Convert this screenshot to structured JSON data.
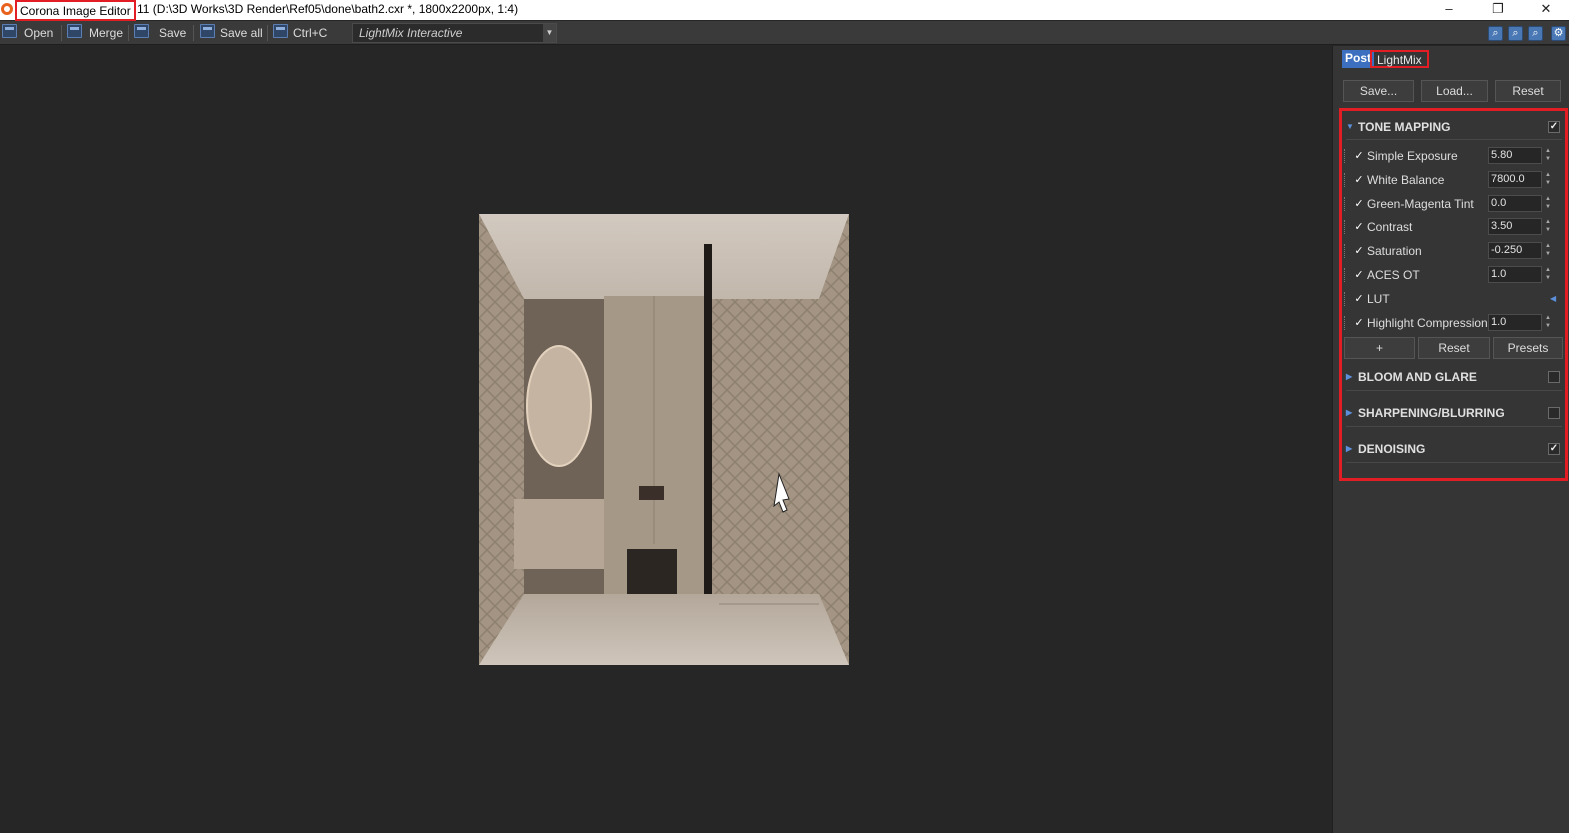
{
  "titlebar": {
    "app_name": "Corona Image Editor",
    "doc_info": "11 (D:\\3D Works\\3D Render\\Ref05\\done\\bath2.cxr *, 1800x2200px, 1:4)",
    "minimize": "–",
    "restore": "❐",
    "close": "✕"
  },
  "toolbar": {
    "open_label": "Open",
    "merge_label": "Merge",
    "save_label": "Save",
    "save_all_label": "Save all",
    "copy_label": "Ctrl+C",
    "mode_select": "LightMix Interactive",
    "zoom_icons": [
      "zoom-fit-icon",
      "zoom-out-icon",
      "zoom-in-icon",
      "settings-icon"
    ]
  },
  "panel": {
    "tabs": [
      "Post",
      "LightMix"
    ],
    "save_button": "Save...",
    "load_button": "Load...",
    "reset_button": "Reset",
    "tone_mapping": {
      "title": "TONE MAPPING",
      "enabled": "✓",
      "rows": [
        {
          "name": "Simple Exposure",
          "value": "5.80",
          "checked": "✓"
        },
        {
          "name": "White Balance",
          "value": "7800.0",
          "checked": "✓"
        },
        {
          "name": "Green-Magenta Tint",
          "value": "0.0",
          "checked": "✓"
        },
        {
          "name": "Contrast",
          "value": "3.50",
          "checked": "✓"
        },
        {
          "name": "Saturation",
          "value": "-0.250",
          "checked": "✓"
        },
        {
          "name": "ACES OT",
          "value": "1.0",
          "checked": "✓"
        },
        {
          "name": "LUT",
          "value": "",
          "checked": "✓"
        },
        {
          "name": "Highlight Compression",
          "value": "1.0",
          "checked": "✓"
        }
      ],
      "add_button": "+",
      "reset_button": "Reset",
      "presets_button": "Presets"
    },
    "bloom": {
      "title": "BLOOM AND GLARE",
      "enabled": ""
    },
    "sharpening": {
      "title": "SHARPENING/BLURRING",
      "enabled": ""
    },
    "denoising": {
      "title": "DENOISING",
      "enabled": "✓"
    }
  }
}
